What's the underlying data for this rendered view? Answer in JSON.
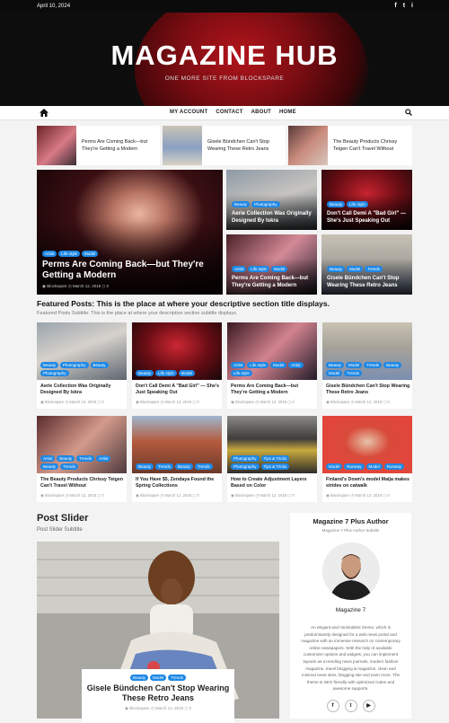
{
  "topbar": {
    "date": "April 10, 2024",
    "social": [
      "f",
      "t",
      "i"
    ]
  },
  "site": {
    "title": "MAGAZINE HUB",
    "tagline": "ONE MORE SITE FROM BLOCKSPARE"
  },
  "nav": {
    "home_icon": "home-icon",
    "items": [
      "MY ACCOUNT",
      "CONTACT",
      "ABOUT",
      "HOME"
    ],
    "search_icon": "search-icon"
  },
  "ticker": [
    {
      "title": "Perms Are Coming Back—but They're Getting a Modern"
    },
    {
      "title": "Gisele Bündchen Can't Stop Wearing These Retro Jeans"
    },
    {
      "title": "The Beauty Products Chrissy Teigen Can't Travel Without"
    }
  ],
  "main_posts": {
    "big": {
      "cats": [
        "Artist",
        "Life style",
        "Model"
      ],
      "title": "Perms Are Coming Back—but They're Getting a Modern",
      "author": "Blockspare",
      "date": "March 12, 2018",
      "comments": "0"
    },
    "small": [
      {
        "cats": [
          "Beauty",
          "Photography"
        ],
        "title": "Aerie Collection Was Originally Designed By Iskra"
      },
      {
        "cats": [
          "Beauty",
          "Life style"
        ],
        "title": "Don't Call Demi A \"Bad Girl\" — She's Just Speaking Out"
      },
      {
        "cats": [
          "Artist",
          "Life style",
          "Model"
        ],
        "title": "Perms Are Coming Back—but They're Getting a Modern"
      },
      {
        "cats": [
          "Beauty",
          "Model",
          "Trends"
        ],
        "title": "Gisele Bündchen Can't Stop Wearing These Retro Jeans"
      }
    ]
  },
  "featured": {
    "title": "Featured Posts: This is the place at where your descriptive section title displays.",
    "subtitle": "Featured Posts Subtitle: This is the place at where your descriptive section subtitle displays.",
    "posts": [
      {
        "cats": [
          "Beauty",
          "Photography",
          "Beauty",
          "Photography"
        ],
        "title": "Aerie Collection Was Originally Designed By Iskra",
        "author": "Blockspare",
        "date": "March 12, 2018",
        "comments": "0"
      },
      {
        "cats": [
          "Beauty",
          "Life style",
          "Model"
        ],
        "title": "Don't Call Demi A \"Bad Girl\" — She's Just Speaking Out",
        "author": "Blockspare",
        "date": "March 12, 2018",
        "comments": "0"
      },
      {
        "cats": [
          "Artist",
          "Life style",
          "Model",
          "Artist",
          "Life style"
        ],
        "title": "Perms Are Coming Back—but They're Getting a Modern",
        "author": "Blockspare",
        "date": "March 12, 2018",
        "comments": "0"
      },
      {
        "cats": [
          "Beauty",
          "Model",
          "Trends",
          "Beauty",
          "Model",
          "Trends"
        ],
        "title": "Gisele Bündchen Can't Stop Wearing These Retro Jeans",
        "author": "Blockspare",
        "date": "March 12, 2018",
        "comments": "0"
      },
      {
        "cats": [
          "Artist",
          "Beauty",
          "Trends",
          "Artist",
          "Beauty",
          "Trends"
        ],
        "title": "The Beauty Products Chrissy Teigen Can't Travel Without",
        "author": "Blockspare",
        "date": "March 12, 2018",
        "comments": "0"
      },
      {
        "cats": [
          "Beauty",
          "Trends",
          "Beauty",
          "Trends"
        ],
        "title": "If You Have $5, Zendaya Found the Spring Collections",
        "author": "Blockspare",
        "date": "March 12, 2018",
        "comments": "0"
      },
      {
        "cats": [
          "Photography",
          "Tips & Tricks",
          "Photography",
          "Tips & Tricks"
        ],
        "title": "How to Create Adjustment Layers Based on Color",
        "author": "Blockspare",
        "date": "March 12, 2018",
        "comments": "0"
      },
      {
        "cats": [
          "Model",
          "Runway",
          "Model",
          "Runway"
        ],
        "title": "Finland's Down's model Maija makes strides on catwalk",
        "author": "Blockspare",
        "date": "March 12, 2018",
        "comments": "0"
      }
    ]
  },
  "post_slider": {
    "title": "Post Slider",
    "subtitle": "Post Slider Subtitle",
    "slide": {
      "cats": [
        "Beauty",
        "Model",
        "Trends"
      ],
      "title": "Gisele Bündchen Can't Stop Wearing These Retro Jeans",
      "author": "Blockspare",
      "date": "March 12, 2018",
      "comments": "0"
    }
  },
  "author": {
    "title": "Magazine 7 Plus Author",
    "subtitle": "Magazine 7 Plus Author Subtitle",
    "name": "Magazine 7",
    "bio": "An elegant and minimalistic theme, which is predominantly designed for a web news portal and magazine with an immense research on contemporary online newspapers. With the help of available customizer options and widgets, you can implement layouts as a trending news journals, modern fashion magazine, travel blogging & magazine, clean and minimal news sites, blogging site and even more. The theme is SEO friendly with optimized codes and awesome supports.",
    "social": [
      "f",
      "t",
      "▶"
    ]
  },
  "colors": {
    "accent": "#1e88e5",
    "dark": "#0b0b0b",
    "hero_red": "#b3141c"
  }
}
